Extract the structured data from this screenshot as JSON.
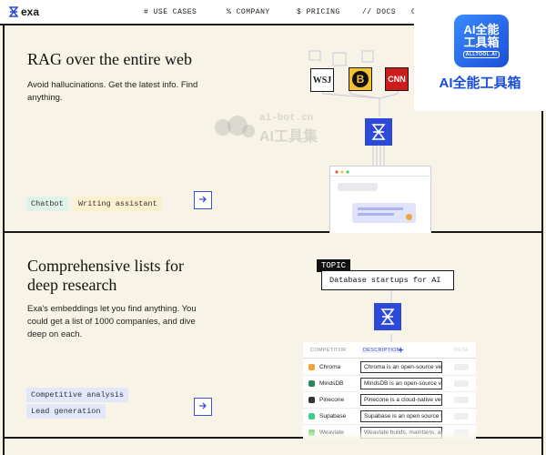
{
  "nav": {
    "logo": "exa",
    "links": [
      "# USE CASES",
      "% COMPANY",
      "$  PRICING",
      "// DOCS",
      "C"
    ]
  },
  "badge": {
    "line1": "AI全能",
    "line2": "工具箱",
    "small": "ALLTOOL.AI",
    "caption": "AI全能工具箱"
  },
  "section1": {
    "title": "RAG over the entire web",
    "description": "Avoid hallucinations. Get the latest info. Find anything.",
    "tags": [
      "Chatbot",
      "Writing assistant"
    ],
    "news_logos": [
      "WSJ",
      "B",
      "CNN"
    ],
    "watermark_line1": "ai-bot.cn",
    "watermark_line2": "AI工具集"
  },
  "section2": {
    "title_line1": "Comprehensive lists for",
    "title_line2": "deep research",
    "description": "Exa's embeddings let you find anything. You could get a list of 1000 companies, and dive deep on each.",
    "tags": [
      "Competitive analysis",
      "Lead generation"
    ],
    "topic_label": "TOPIC",
    "topic_query": "Database startups for AI",
    "table": {
      "headers": [
        "COMPETITOR",
        "DESCRIPTION"
      ],
      "extra_header": "DETA",
      "rows": [
        {
          "name": "Chroma",
          "desc": "Chroma is an open-source vect...",
          "color": "#f2a33a"
        },
        {
          "name": "MindsDB",
          "desc": "MindsDB is an open-source vir...",
          "color": "#2b8a5a"
        },
        {
          "name": "Pinecone",
          "desc": "Pinecone is a cloud-native vect...",
          "color": "#333333"
        },
        {
          "name": "Supabase",
          "desc": "Supabase is an open source Fir...",
          "color": "#3ecf8e"
        },
        {
          "name": "Weaviate",
          "desc": "Weaviate builds, maintains, and...",
          "color": "#6fcf6f"
        }
      ]
    }
  },
  "colors": {
    "accent": "#2c49d8",
    "background": "#f7f3e6",
    "tag_green": "#dff3e6",
    "tag_yellow": "#fbf0cf",
    "tag_blue": "#e3e7fb"
  }
}
